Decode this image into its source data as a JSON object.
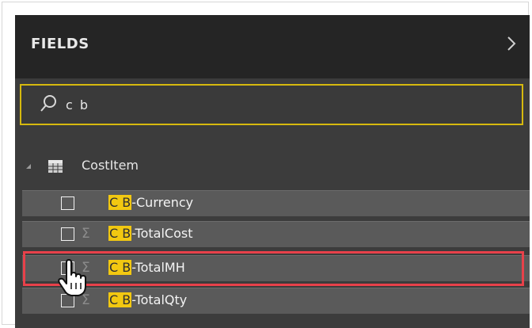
{
  "panel": {
    "title": "FIELDS",
    "collapse_icon": "chevron-right-icon"
  },
  "search": {
    "value": "c b",
    "icon": "search-icon",
    "border_color": "#d6b90e"
  },
  "table": {
    "name": "CostItem",
    "icon": "table-icon",
    "expand_icon": "expanded-triangle-icon"
  },
  "fields": [
    {
      "match": "C B",
      "suffix": "-Currency",
      "sigma": ""
    },
    {
      "match": "C B",
      "suffix": "-TotalCost",
      "sigma": "Σ"
    },
    {
      "match": "C B",
      "suffix": "-TotalMH",
      "sigma": "Σ"
    },
    {
      "match": "C B",
      "suffix": "-TotalQty",
      "sigma": "Σ"
    }
  ],
  "colors": {
    "highlight": "#f2c811",
    "selection_box": "#e8414a",
    "header_bg": "#252525",
    "row_bg": "#5a5a5a"
  },
  "cursor_icon": "hand-pointer-icon"
}
